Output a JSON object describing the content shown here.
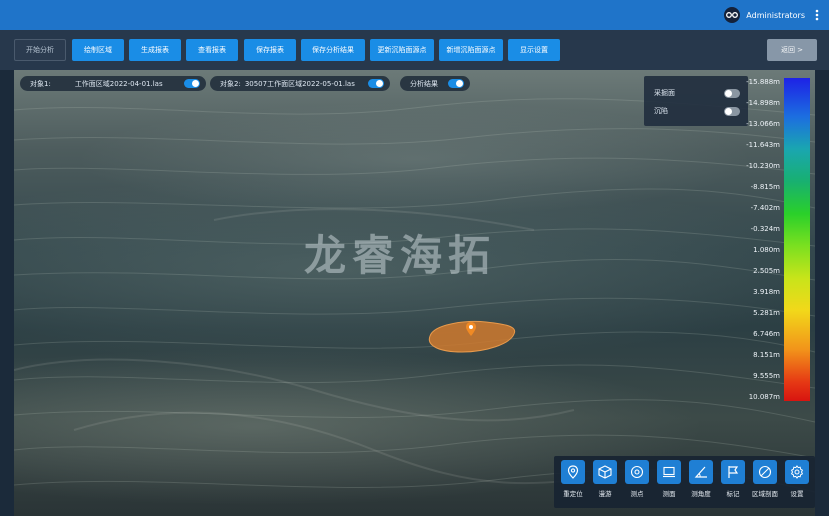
{
  "header": {
    "user": "Administrators",
    "more_icon": "more-vertical-icon"
  },
  "toolbar": {
    "start_analysis": "开始分析",
    "buttons": [
      "绘制区域",
      "生成报表",
      "查看报表",
      "保存报表",
      "保存分析结果",
      "更新沉陷面源点",
      "新增沉陷面源点",
      "显示设置"
    ],
    "back": "返回 >"
  },
  "objects": {
    "obj1_label": "对象1:",
    "obj1_value": "工作面区域2022-04-01.las",
    "obj2_label": "对象2:",
    "obj2_value": "30507工作面区域2022-05-01.las",
    "result_label": "分析结果"
  },
  "layers": {
    "mining_area": "采掘面",
    "subsidence": "沉陷"
  },
  "watermark": "龙睿海拓",
  "legend": {
    "ticks": [
      "-15.888m",
      "-14.898m",
      "-13.066m",
      "-11.643m",
      "-10.230m",
      "-8.815m",
      "-7.402m",
      "-0.324m",
      "1.080m",
      "2.505m",
      "3.918m",
      "5.281m",
      "6.746m",
      "8.151m",
      "9.555m",
      "10.087m"
    ]
  },
  "tools": [
    {
      "label": "重定位",
      "icon": "location-pin-icon"
    },
    {
      "label": "漫游",
      "icon": "cube-icon"
    },
    {
      "label": "测点",
      "icon": "target-icon"
    },
    {
      "label": "测面",
      "icon": "surface-icon"
    },
    {
      "label": "测角度",
      "icon": "angle-icon"
    },
    {
      "label": "标记",
      "icon": "flag-icon"
    },
    {
      "label": "区域剖面",
      "icon": "section-icon"
    },
    {
      "label": "设置",
      "icon": "gear-icon"
    }
  ],
  "colors": {
    "accent": "#1a8de6",
    "titlebar": "#1f74c9",
    "marker": "#e67e22"
  }
}
